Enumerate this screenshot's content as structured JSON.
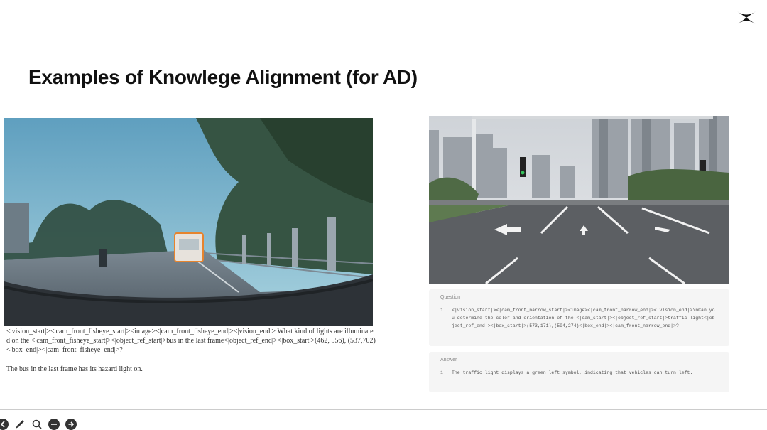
{
  "slide": {
    "title": "Examples of Knowlege Alignment (for AD)"
  },
  "icons": {
    "logo": "x-logo-icon",
    "toolbar": [
      "arrow-left-icon",
      "pen-icon",
      "zoom-icon",
      "more-icon",
      "arrow-right-icon"
    ]
  },
  "left_example": {
    "prompt": "<|vision_start|><|cam_front_fisheye_start|><image><|cam_front_fisheye_end|><|vision_end|> What kind of lights are illuminated on the <|cam_front_fisheye_start|><|object_ref_start|>bus in the last frame<|object_ref_end|><|box_start|>(462, 556), (537,702)<|box_end|><|cam_front_fisheye_end|>?",
    "answer": "The bus in the last frame has its hazard light on."
  },
  "right_example": {
    "question_label": "Question",
    "question_num": "1",
    "question_text": "<|vision_start|><|cam_front_narrow_start|><image><|cam_front_narrow_end|><|vision_end|>\\nCan you determine the color and orientation of the <|cam_start|><|object_ref_start|>traffic light<|object_ref_end|><|box_start|>(573,171),(594,274)<|box_end|><|cam_front_narrow_end|>?",
    "answer_label": "Answer",
    "answer_num": "1",
    "answer_text": "The traffic light displays a green left symbol, indicating that vehicles can turn left."
  },
  "colors": {
    "title": "#111111",
    "panel_bg": "#f5f5f5",
    "sky_left": "#7fb6cc",
    "road_right": "#5c5f63"
  }
}
